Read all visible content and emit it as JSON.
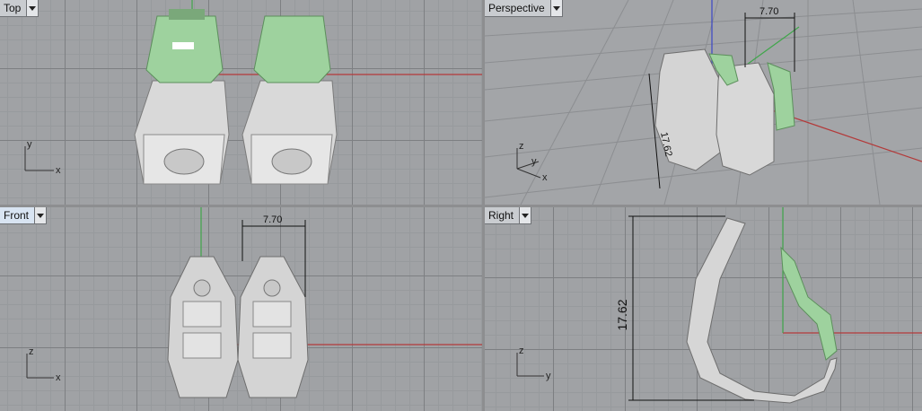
{
  "viewports": {
    "top": {
      "title": "Top"
    },
    "perspective": {
      "title": "Perspective"
    },
    "front": {
      "title": "Front"
    },
    "right": {
      "title": "Right"
    }
  },
  "axes": {
    "x": "x",
    "y": "y",
    "z": "z"
  },
  "dimensions": {
    "width": "7.70",
    "height": "17.62"
  },
  "colors": {
    "x_axis": "#b33a3a",
    "y_axis": "#3fa64a",
    "z_axis": "#3a47c6",
    "model_metal": "#d8d8d8",
    "model_green": "#9ed29e",
    "active_tab": "#d8e4f2"
  }
}
